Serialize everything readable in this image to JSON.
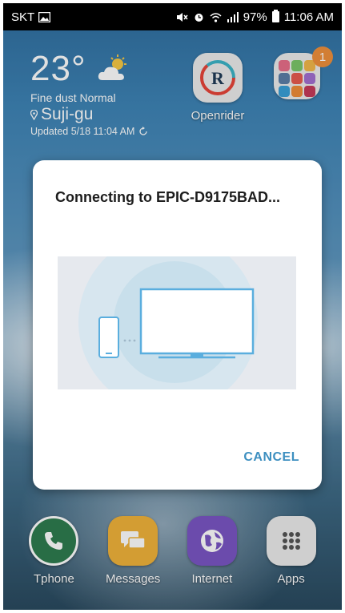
{
  "status_bar": {
    "carrier": "SKT",
    "battery": "97%",
    "time": "11:06 AM",
    "battery_level": 0.97
  },
  "weather": {
    "temperature": "23°",
    "dust": "Fine dust Normal",
    "location": "Suji-gu",
    "updated": "Updated 5/18 11:04 AM",
    "icon": "partly-cloudy-icon"
  },
  "home": {
    "openrider_label": "Openrider",
    "folder_badge": "1"
  },
  "dialog": {
    "title": "Connecting to EPIC-D9175BAD...",
    "cancel_label": "CANCEL"
  },
  "dock": [
    {
      "label": "Tphone",
      "icon": "phone-icon",
      "color": "#2e7d4f"
    },
    {
      "label": "Messages",
      "icon": "messages-icon",
      "color": "#f1b33b"
    },
    {
      "label": "Internet",
      "icon": "internet-icon",
      "color": "#7a56c4"
    },
    {
      "label": "Apps",
      "icon": "apps-grid-icon",
      "color": "#ececec"
    }
  ],
  "colors": {
    "accent": "#3d8fc0",
    "illustration_line": "#5aaede"
  }
}
